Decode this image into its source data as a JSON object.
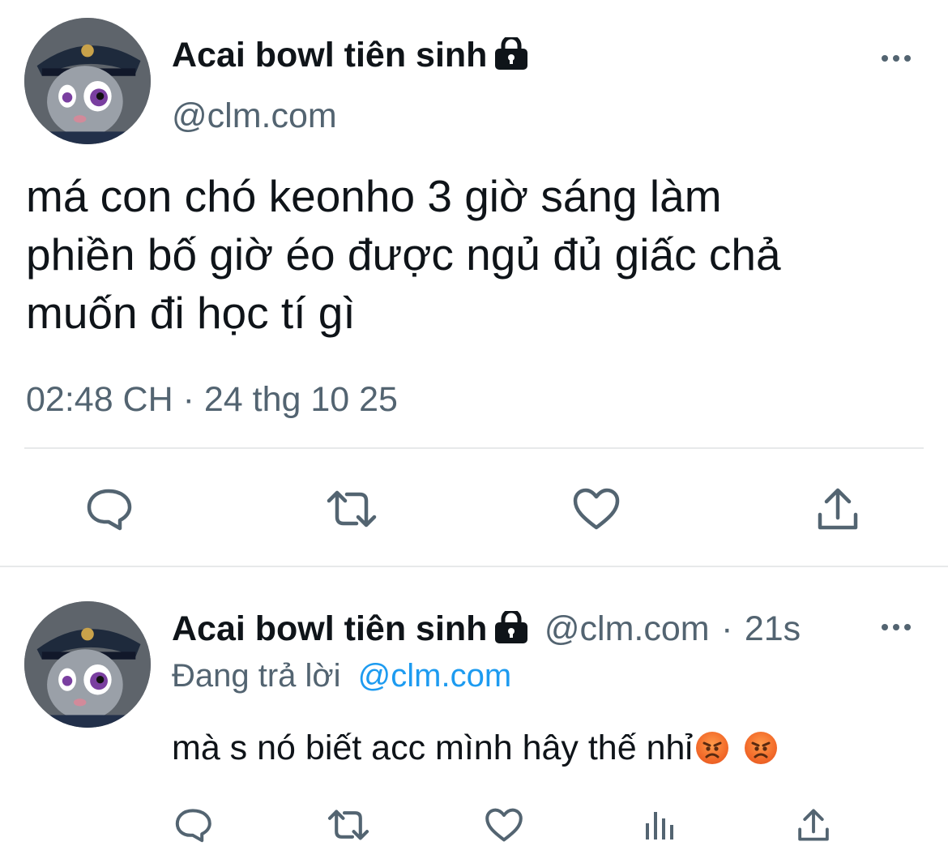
{
  "tweet": {
    "author_name": "Acai bowl tiên sinh",
    "author_handle": "@clm.com",
    "text_lines": [
      "má con chó keonho 3 giờ sáng làm",
      "phiền bố giờ éo được ngủ đủ giấc chả",
      "muốn đi học tí gì"
    ],
    "timestamp": "02:48 CH · 24 thg 10 25",
    "actions": [
      "reply-icon",
      "retweet-icon",
      "like-icon",
      "share-icon"
    ]
  },
  "reply": {
    "author_name": "Acai bowl tiên sinh",
    "author_handle": "@clm.com",
    "separator": "·",
    "time": "21s",
    "replying_label": "Đang trả lời",
    "replying_to": "@clm.com",
    "text": "mà s nó biết acc mình hây thế nhỉ",
    "emojis": [
      "angry-face-emoji",
      "angry-face-emoji"
    ],
    "actions": [
      "reply-icon",
      "retweet-icon",
      "like-icon",
      "views-icon",
      "share-icon"
    ]
  },
  "colors": {
    "text": "#0f1419",
    "secondary": "#536471",
    "link": "#1d9bf0",
    "divider": "#e7e9ea"
  }
}
